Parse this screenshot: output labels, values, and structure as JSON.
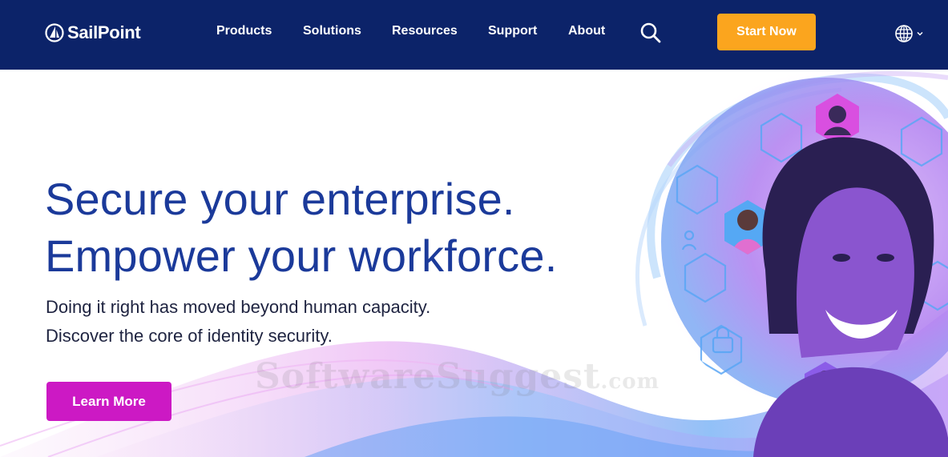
{
  "brand": {
    "name": "SailPoint"
  },
  "nav": {
    "items": [
      {
        "label": "Products"
      },
      {
        "label": "Solutions"
      },
      {
        "label": "Resources"
      },
      {
        "label": "Support"
      },
      {
        "label": "About"
      }
    ],
    "search_icon": "search-icon",
    "cta_label": "Start Now",
    "language_icon": "globe-icon"
  },
  "hero": {
    "headline_line1": "Secure your enterprise.",
    "headline_line2": "Empower your workforce.",
    "subtext_line1": "Doing it right has moved beyond human capacity.",
    "subtext_line2": "Discover the core of identity security.",
    "button_label": "Learn More"
  },
  "watermark": {
    "text": "SoftwareSuggest",
    "suffix": ".com"
  },
  "colors": {
    "nav_background": "#0c2369",
    "cta_orange": "#fba51e",
    "headline_blue": "#1b3a9a",
    "button_magenta": "#cc19c4"
  }
}
